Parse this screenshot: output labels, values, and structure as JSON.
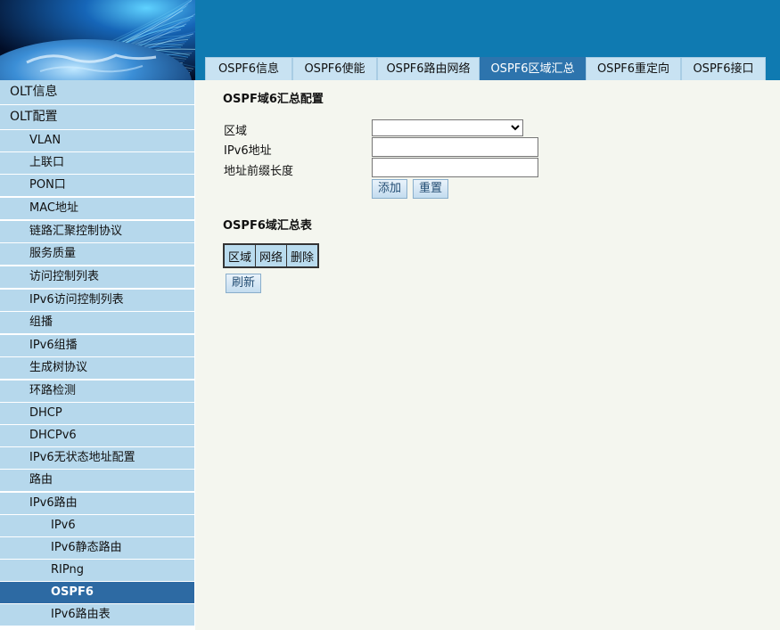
{
  "tabs": [
    {
      "label": "OSPF6信息"
    },
    {
      "label": "OSPF6使能"
    },
    {
      "label": "OSPF6路由网络"
    },
    {
      "label": "OSPF6区域汇总"
    },
    {
      "label": "OSPF6重定向"
    },
    {
      "label": "OSPF6接口"
    }
  ],
  "active_tab": "OSPF6区域汇总",
  "sidebar": {
    "items": [
      {
        "label": "OLT信息",
        "level": 0
      },
      {
        "label": "OLT配置",
        "level": 0
      },
      {
        "label": "VLAN",
        "level": 1
      },
      {
        "label": "上联口",
        "level": 1
      },
      {
        "label": "PON口",
        "level": 1
      },
      {
        "label": "MAC地址",
        "level": 1
      },
      {
        "label": "链路汇聚控制协议",
        "level": 1
      },
      {
        "label": "服务质量",
        "level": 1
      },
      {
        "label": "访问控制列表",
        "level": 1
      },
      {
        "label": "IPv6访问控制列表",
        "level": 1
      },
      {
        "label": "组播",
        "level": 1
      },
      {
        "label": "IPv6组播",
        "level": 1
      },
      {
        "label": "生成树协议",
        "level": 1
      },
      {
        "label": "环路检测",
        "level": 1
      },
      {
        "label": "DHCP",
        "level": 1
      },
      {
        "label": "DHCPv6",
        "level": 1
      },
      {
        "label": "IPv6无状态地址配置",
        "level": 1
      },
      {
        "label": "路由",
        "level": 1
      },
      {
        "label": "IPv6路由",
        "level": 1
      },
      {
        "label": "IPv6",
        "level": 2
      },
      {
        "label": "IPv6静态路由",
        "level": 2
      },
      {
        "label": "RIPng",
        "level": 2
      },
      {
        "label": "OSPF6",
        "level": 2,
        "active": true
      },
      {
        "label": "IPv6路由表",
        "level": 2
      }
    ]
  },
  "config": {
    "title": "OSPF域6汇总配置",
    "area_label": "区域",
    "area_value": "",
    "ipv6_label": "IPv6地址",
    "ipv6_value": "",
    "prefix_label": "地址前缀长度",
    "prefix_value": "",
    "add_button": "添加",
    "reset_button": "重置"
  },
  "summary": {
    "title": "OSPF6域汇总表",
    "columns": [
      "区域",
      "网络",
      "删除"
    ],
    "refresh_button": "刷新"
  },
  "colors": {
    "header_blue": "#0f7ab1",
    "tab_bg": "#c8e2f2",
    "active_blue": "#2d74ad",
    "sidebar_bg": "#b6d8ec",
    "content_bg": "#f4f6ef"
  }
}
